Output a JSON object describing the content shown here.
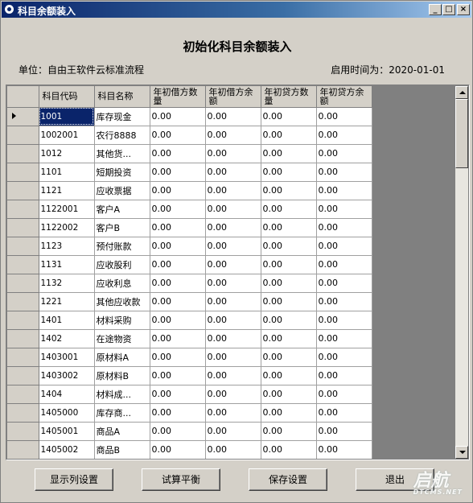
{
  "window": {
    "title": "科目余额装入",
    "min_label": "_",
    "max_label": "□",
    "close_label": "×"
  },
  "heading": "初始化科目余额装入",
  "info": {
    "unit": "单位：自由王软件云标准流程",
    "start_time": "启用时间为：2020-01-01"
  },
  "table": {
    "headers": [
      "科目代码",
      "科目名称",
      "年初借方数量",
      "年初借方余额",
      "年初贷方数量",
      "年初贷方余额"
    ],
    "rows": [
      [
        "1001",
        "库存现金",
        "0.00",
        "0.00",
        "0.00",
        "0.00"
      ],
      [
        "1002001",
        "农行8888",
        "0.00",
        "0.00",
        "0.00",
        "0.00"
      ],
      [
        "1012",
        "其他货...",
        "0.00",
        "0.00",
        "0.00",
        "0.00"
      ],
      [
        "1101",
        "短期投资",
        "0.00",
        "0.00",
        "0.00",
        "0.00"
      ],
      [
        "1121",
        "应收票据",
        "0.00",
        "0.00",
        "0.00",
        "0.00"
      ],
      [
        "1122001",
        "客户A",
        "0.00",
        "0.00",
        "0.00",
        "0.00"
      ],
      [
        "1122002",
        "客户B",
        "0.00",
        "0.00",
        "0.00",
        "0.00"
      ],
      [
        "1123",
        "预付账款",
        "0.00",
        "0.00",
        "0.00",
        "0.00"
      ],
      [
        "1131",
        "应收股利",
        "0.00",
        "0.00",
        "0.00",
        "0.00"
      ],
      [
        "1132",
        "应收利息",
        "0.00",
        "0.00",
        "0.00",
        "0.00"
      ],
      [
        "1221",
        "其他应收款",
        "0.00",
        "0.00",
        "0.00",
        "0.00"
      ],
      [
        "1401",
        "材料采购",
        "0.00",
        "0.00",
        "0.00",
        "0.00"
      ],
      [
        "1402",
        "在途物资",
        "0.00",
        "0.00",
        "0.00",
        "0.00"
      ],
      [
        "1403001",
        "原材料A",
        "0.00",
        "0.00",
        "0.00",
        "0.00"
      ],
      [
        "1403002",
        "原材料B",
        "0.00",
        "0.00",
        "0.00",
        "0.00"
      ],
      [
        "1404",
        "材料成...",
        "0.00",
        "0.00",
        "0.00",
        "0.00"
      ],
      [
        "1405000",
        "库存商...",
        "0.00",
        "0.00",
        "0.00",
        "0.00"
      ],
      [
        "1405001",
        "商品A",
        "0.00",
        "0.00",
        "0.00",
        "0.00"
      ],
      [
        "1405002",
        "商品B",
        "0.00",
        "0.00",
        "0.00",
        "0.00"
      ]
    ]
  },
  "buttons": {
    "columns": "显示列设置",
    "balance": "试算平衡",
    "save": "保存设置",
    "exit": "退出"
  },
  "watermark": {
    "text": "启航",
    "sub": "DTCMS.NET"
  }
}
